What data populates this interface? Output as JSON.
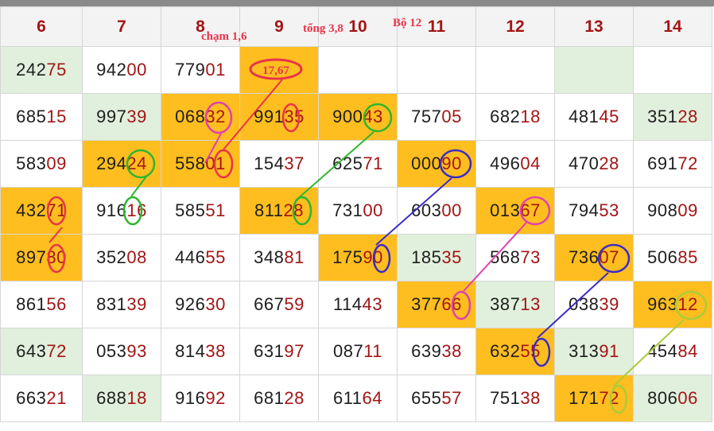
{
  "columns": [
    "6",
    "7",
    "8",
    "9",
    "10",
    "11",
    "12",
    "13",
    "14"
  ],
  "rows": [
    [
      {
        "pre": "242",
        "suf": "75",
        "bg": "green"
      },
      {
        "pre": "942",
        "suf": "00",
        "bg": "white"
      },
      {
        "pre": "779",
        "suf": "01",
        "bg": "white"
      },
      {
        "pre": "",
        "suf": "",
        "bg": "orange"
      },
      {
        "pre": "",
        "suf": "",
        "bg": "white"
      },
      {
        "pre": "",
        "suf": "",
        "bg": "white"
      },
      {
        "pre": "",
        "suf": "",
        "bg": "white"
      },
      {
        "pre": "",
        "suf": "",
        "bg": "green"
      },
      {
        "pre": "",
        "suf": "",
        "bg": "white"
      }
    ],
    [
      {
        "pre": "685",
        "suf": "15",
        "bg": "white"
      },
      {
        "pre": "997",
        "suf": "39",
        "bg": "green"
      },
      {
        "pre": "068",
        "suf": "32",
        "bg": "orange"
      },
      {
        "pre": "991",
        "suf": "35",
        "bg": "orange"
      },
      {
        "pre": "900",
        "suf": "43",
        "bg": "orange"
      },
      {
        "pre": "757",
        "suf": "05",
        "bg": "white"
      },
      {
        "pre": "682",
        "suf": "18",
        "bg": "white"
      },
      {
        "pre": "481",
        "suf": "45",
        "bg": "white"
      },
      {
        "pre": "351",
        "suf": "28",
        "bg": "green"
      }
    ],
    [
      {
        "pre": "583",
        "suf": "09",
        "bg": "white"
      },
      {
        "pre": "294",
        "suf": "24",
        "bg": "orange"
      },
      {
        "pre": "558",
        "suf": "01",
        "bg": "orange"
      },
      {
        "pre": "154",
        "suf": "37",
        "bg": "white"
      },
      {
        "pre": "625",
        "suf": "71",
        "bg": "white"
      },
      {
        "pre": "000",
        "suf": "90",
        "bg": "orange"
      },
      {
        "pre": "496",
        "suf": "04",
        "bg": "white"
      },
      {
        "pre": "470",
        "suf": "28",
        "bg": "white"
      },
      {
        "pre": "691",
        "suf": "72",
        "bg": "white"
      }
    ],
    [
      {
        "pre": "432",
        "suf": "71",
        "bg": "orange"
      },
      {
        "pre": "916",
        "suf": "16",
        "bg": "white"
      },
      {
        "pre": "585",
        "suf": "51",
        "bg": "white"
      },
      {
        "pre": "811",
        "suf": "28",
        "bg": "orange"
      },
      {
        "pre": "731",
        "suf": "00",
        "bg": "white"
      },
      {
        "pre": "603",
        "suf": "00",
        "bg": "white"
      },
      {
        "pre": "013",
        "suf": "67",
        "bg": "orange"
      },
      {
        "pre": "794",
        "suf": "53",
        "bg": "white"
      },
      {
        "pre": "908",
        "suf": "09",
        "bg": "white"
      }
    ],
    [
      {
        "pre": "897",
        "suf": "80",
        "bg": "orange"
      },
      {
        "pre": "352",
        "suf": "08",
        "bg": "white"
      },
      {
        "pre": "446",
        "suf": "55",
        "bg": "white"
      },
      {
        "pre": "348",
        "suf": "81",
        "bg": "white"
      },
      {
        "pre": "175",
        "suf": "90",
        "bg": "orange"
      },
      {
        "pre": "185",
        "suf": "35",
        "bg": "green"
      },
      {
        "pre": "568",
        "suf": "73",
        "bg": "white"
      },
      {
        "pre": "736",
        "suf": "07",
        "bg": "orange"
      },
      {
        "pre": "506",
        "suf": "85",
        "bg": "white"
      }
    ],
    [
      {
        "pre": "861",
        "suf": "56",
        "bg": "white"
      },
      {
        "pre": "831",
        "suf": "39",
        "bg": "white"
      },
      {
        "pre": "926",
        "suf": "30",
        "bg": "white"
      },
      {
        "pre": "667",
        "suf": "59",
        "bg": "white"
      },
      {
        "pre": "114",
        "suf": "43",
        "bg": "white"
      },
      {
        "pre": "377",
        "suf": "66",
        "bg": "orange"
      },
      {
        "pre": "387",
        "suf": "13",
        "bg": "green"
      },
      {
        "pre": "038",
        "suf": "39",
        "bg": "white"
      },
      {
        "pre": "963",
        "suf": "12",
        "bg": "orange"
      }
    ],
    [
      {
        "pre": "643",
        "suf": "72",
        "bg": "green"
      },
      {
        "pre": "053",
        "suf": "93",
        "bg": "white"
      },
      {
        "pre": "814",
        "suf": "38",
        "bg": "white"
      },
      {
        "pre": "631",
        "suf": "97",
        "bg": "white"
      },
      {
        "pre": "087",
        "suf": "11",
        "bg": "white"
      },
      {
        "pre": "639",
        "suf": "38",
        "bg": "white"
      },
      {
        "pre": "632",
        "suf": "55",
        "bg": "orange"
      },
      {
        "pre": "313",
        "suf": "91",
        "bg": "green"
      },
      {
        "pre": "454",
        "suf": "84",
        "bg": "white"
      }
    ],
    [
      {
        "pre": "663",
        "suf": "21",
        "bg": "white"
      },
      {
        "pre": "688",
        "suf": "18",
        "bg": "green"
      },
      {
        "pre": "916",
        "suf": "92",
        "bg": "white"
      },
      {
        "pre": "681",
        "suf": "28",
        "bg": "white"
      },
      {
        "pre": "611",
        "suf": "64",
        "bg": "white"
      },
      {
        "pre": "655",
        "suf": "57",
        "bg": "white"
      },
      {
        "pre": "751",
        "suf": "38",
        "bg": "white"
      },
      {
        "pre": "171",
        "suf": "72",
        "bg": "orange"
      },
      {
        "pre": "806",
        "suf": "06",
        "bg": "green"
      }
    ]
  ],
  "annotations": {
    "cham": "chạm 1,6",
    "tong": "tổng 3,8",
    "bo": "Bộ 12",
    "circled_value": "17,67"
  },
  "colors": {
    "header_text": "#a31515",
    "orange": "#ffbe1f",
    "green_cell": "#e1f0dc",
    "red_marker": "#e8344a",
    "pink_marker": "#e040b0",
    "green_marker": "#2fb52f",
    "blue_marker": "#3b2cc7",
    "lime_marker": "#a8cc3a"
  }
}
